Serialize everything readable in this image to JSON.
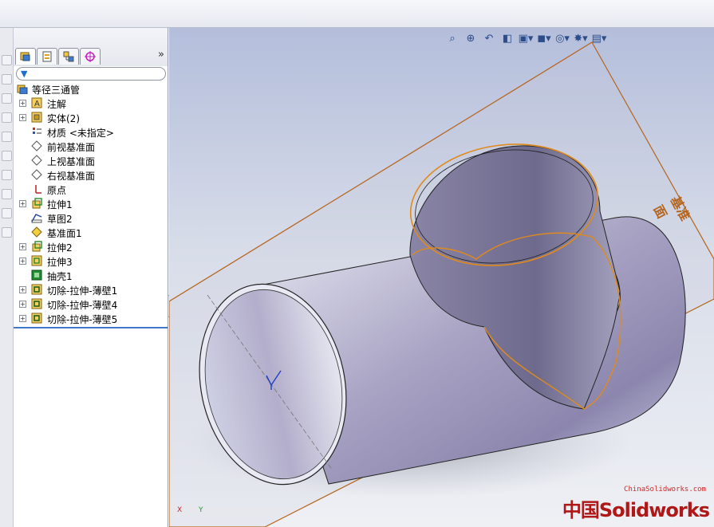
{
  "feature_tree": {
    "root": "等径三通管",
    "items": [
      {
        "label": "注解",
        "expandable": true,
        "icon": "annotation-icon"
      },
      {
        "label": "实体(2)",
        "expandable": true,
        "icon": "solid-bodies-icon"
      },
      {
        "label": "材质 <未指定>",
        "expandable": false,
        "icon": "material-icon"
      },
      {
        "label": "前视基准面",
        "expandable": false,
        "icon": "plane-icon"
      },
      {
        "label": "上视基准面",
        "expandable": false,
        "icon": "plane-icon"
      },
      {
        "label": "右视基准面",
        "expandable": false,
        "icon": "plane-icon"
      },
      {
        "label": "原点",
        "expandable": false,
        "icon": "origin-icon"
      },
      {
        "label": "拉伸1",
        "expandable": true,
        "icon": "extrude-icon"
      },
      {
        "label": "草图2",
        "expandable": false,
        "icon": "sketch-icon"
      },
      {
        "label": "基准面1",
        "expandable": false,
        "icon": "plane-yellow-icon"
      },
      {
        "label": "拉伸2",
        "expandable": true,
        "icon": "extrude-icon"
      },
      {
        "label": "拉伸3",
        "expandable": true,
        "icon": "extrude-thin-icon"
      },
      {
        "label": "抽壳1",
        "expandable": false,
        "icon": "shell-icon"
      },
      {
        "label": "切除-拉伸-薄壁1",
        "expandable": true,
        "icon": "cut-thin-icon"
      },
      {
        "label": "切除-拉伸-薄壁4",
        "expandable": true,
        "icon": "cut-thin-icon"
      },
      {
        "label": "切除-拉伸-薄壁5",
        "expandable": true,
        "icon": "cut-thin-icon"
      }
    ]
  },
  "panel": {
    "expand_glyph": "»",
    "tabs": [
      "feature-manager",
      "property-manager",
      "configuration-manager",
      "dimxpert-manager"
    ]
  },
  "viewport": {
    "plane_label": "基准面",
    "watermark_url": "ChinaSolidworks.com",
    "watermark_cn": "中国",
    "watermark_brand": "Solidworks",
    "triad_x": "X",
    "triad_y": "Y",
    "toolbar": [
      "zoom-to-fit-icon",
      "zoom-area-icon",
      "previous-view-icon",
      "section-view-icon",
      "view-orientation-icon",
      "display-style-icon",
      "hide-show-icon",
      "appearance-icon",
      "scene-icon"
    ]
  },
  "colors": {
    "plane_edge": "#b5651d",
    "selection": "#e08a1c",
    "tree_accent": "#3f78c8"
  }
}
